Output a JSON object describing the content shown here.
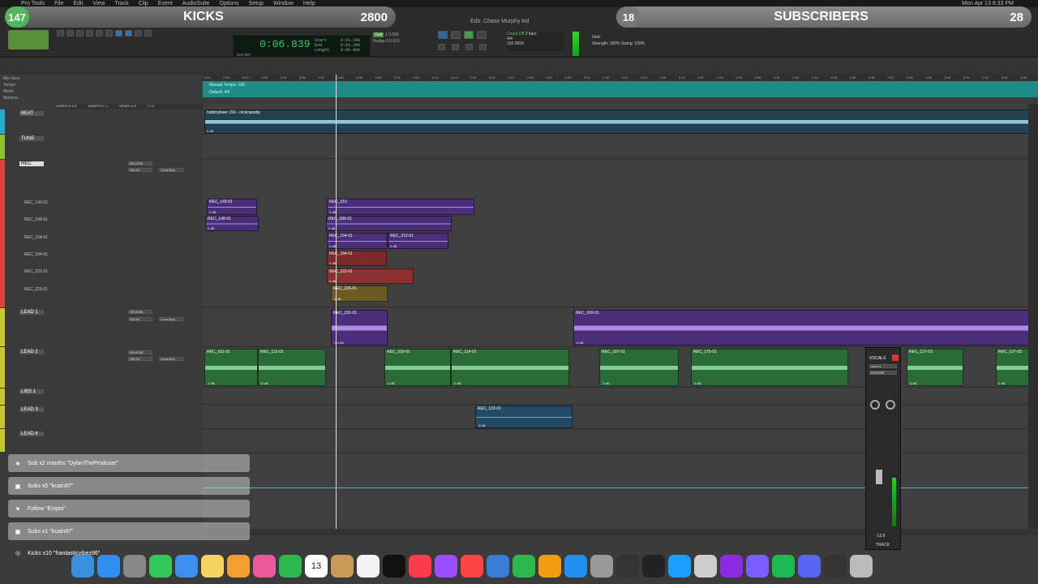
{
  "menubar": {
    "items": [
      "Pro Tools",
      "File",
      "Edit",
      "View",
      "Track",
      "Clip",
      "Event",
      "AudioSuite",
      "Options",
      "Setup",
      "Window",
      "Help"
    ],
    "clock": "Mon Apr 13 6:33 PM"
  },
  "overlay": {
    "left_count": "147",
    "left_label": "KICKS",
    "left_value": "2800",
    "right_count": "18",
    "right_label": "SUBSCRIBERS",
    "right_value": "28"
  },
  "window_title": "Edit: Chase Murphy kid",
  "counter": {
    "main": "0:06.839",
    "start": "Start",
    "end": "End",
    "length": "Length",
    "cursor": "Cursor",
    "s1": "0:03.200",
    "s2": "0:03.209",
    "s3": "0:00.000"
  },
  "tempo": {
    "grid": "Grid",
    "nudge": "Nudge",
    "grid_val": "1 0.000",
    "nudge_val": "0 0.010",
    "bars": "2 bars",
    "meter": "4/4",
    "tempo_val": "150.0000",
    "countoff": "Count Off"
  },
  "strength": {
    "label": "Strength:",
    "value": "100%",
    "swing_label": "Swing:",
    "swing_value": "100%"
  },
  "ruler_rows": [
    "Min:Secs",
    "Tempo",
    "Meter",
    "Markers"
  ],
  "ruler_ticks": [
    "0:01",
    "0:02",
    "0:03",
    "0:04",
    "0:05",
    "0:06",
    "0:07",
    "0:08",
    "0:09",
    "0:10",
    "0:11",
    "0:12",
    "0:13",
    "0:14",
    "0:15",
    "0:16",
    "0:17",
    "0:18",
    "0:19",
    "0:20",
    "0:21",
    "0:22",
    "0:23",
    "0:24",
    "0:25",
    "0:26",
    "0:27",
    "0:28",
    "0:29",
    "0:30",
    "0:31",
    "0:32",
    "0:33",
    "0:34",
    "0:35",
    "0:36",
    "0:37",
    "0:38",
    "0:39",
    "0:40",
    "0:41",
    "0:42",
    "0:43",
    "0:44"
  ],
  "tempo_marker": "Manual Tempo: 150",
  "meter_marker": "Default: 4/4",
  "header_cols": [
    "INSERTS A-E",
    "INSERTS F-J",
    "SENDS A-E",
    "I / O"
  ],
  "tracks": [
    {
      "name": "BEAT",
      "color": "#2fa7c9"
    },
    {
      "name": "TUNE",
      "color": "#8fbf3f"
    },
    {
      "name": "REC",
      "color": "#d8433f",
      "send1": "REVERB",
      "send2": "DELAY",
      "io": "Vocal Bus"
    },
    {
      "name": "LEAD 1",
      "color": "#c7c735",
      "send1": "REVERB",
      "send2": "DELAY",
      "io": "Vocal Bus"
    },
    {
      "name": "LEAD 2",
      "color": "#c7c735",
      "send1": "REVERB",
      "send2": "DELAY",
      "io": "Vocal Bus"
    },
    {
      "name": "LIBS 1",
      "color": "#c7c735"
    },
    {
      "name": "LEAD 3",
      "color": "#c7c735"
    },
    {
      "name": "LEAD 4",
      "color": "#c7c735"
    }
  ],
  "playlists": [
    "REC_143-01",
    "REC_149-01",
    "REC_154-01",
    "REC_184-01",
    "REC_222-01",
    "REC_225-01"
  ],
  "beat_clip": "holdmybeer 150 - nickcassidy",
  "clips": {
    "rec1a": "REC_143-01",
    "rec1b": "REC_210",
    "rec2a": "REC_149-01",
    "rec2b": "REC_180-01",
    "rec3a": "REC_154-01",
    "rec3b": "REC_212-01",
    "rec4": "REC_184-01",
    "rec5": "REC_222-01",
    "rec6": "REC_225-01",
    "lead1a": "REC_231-01",
    "lead1b": "REC_169-01",
    "lead2a": "REC_151-01",
    "lead2b": "REC_113-02",
    "lead2c": "REC_216-01",
    "lead2d": "REC_114-01",
    "lead2e": "REC_187-01",
    "lead2f": "REC_175-01",
    "lead2g": "REC_127-03",
    "lead2h": "REC_127-03",
    "lead3": "REC_123-01"
  },
  "clip_db": {
    "d0": "0 dB",
    "d4": "-4 dB",
    "d5": "-5 dB",
    "d3": "-3 dB",
    "d6": "-6 dB",
    "d7": "-7.5 dB"
  },
  "alerts": [
    {
      "icon": "star",
      "text": "Sub x2 months \"DylanTheProducer\""
    },
    {
      "icon": "gift",
      "text": "Subs x5 \"kcain97\""
    },
    {
      "icon": "heart",
      "text": "Follow \"Empoi\""
    },
    {
      "icon": "gift",
      "text": "Subs x1 \"kcain97\""
    }
  ],
  "last_alert": "Kicks x10 \"frantasticvibez86\"",
  "mixer": {
    "name": "VOCALS",
    "send": "send a",
    "reverb": "REVERB",
    "track_label": "TRACK",
    "vol": "-13.8"
  },
  "dock": [
    "Finder",
    "Safari",
    "Launchpad",
    "Messages",
    "Mail",
    "Notes",
    "Photos",
    "Photos2",
    "FaceTime",
    "Calendar",
    "Contacts",
    "Reminders",
    "TV",
    "Music",
    "Podcasts",
    "News",
    "Keynote",
    "Numbers",
    "Pages",
    "App Store",
    "System Settings",
    "Logic",
    "iLok",
    "Circle",
    "Compressor",
    "Avid",
    "Pro Tools",
    "Spotify",
    "Discord",
    "OBS",
    "Trash"
  ],
  "calendar_day": "13"
}
